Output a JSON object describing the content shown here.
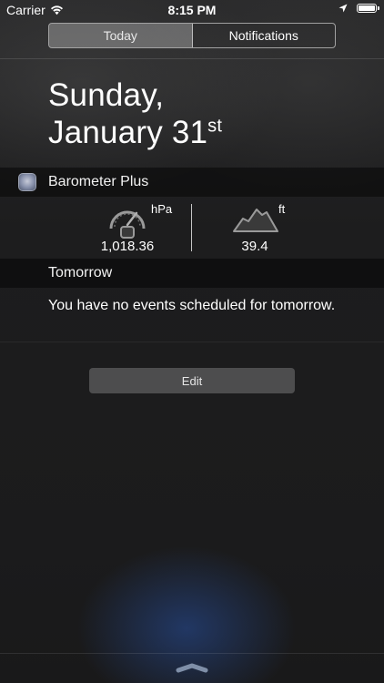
{
  "status_bar": {
    "carrier": "Carrier",
    "time": "8:15 PM",
    "icons": [
      "wifi-icon",
      "location-arrow-icon",
      "battery-icon"
    ]
  },
  "tabs": [
    {
      "label": "Today",
      "selected": true
    },
    {
      "label": "Notifications",
      "selected": false
    }
  ],
  "date": {
    "weekday": "Sunday,",
    "month_day": "January 31",
    "ordinal_suffix": "st"
  },
  "widget": {
    "title": "Barometer Plus",
    "pressure": {
      "unit": "hPa",
      "value": "1,018.36",
      "icon": "barometer-gauge-icon"
    },
    "altitude": {
      "unit": "ft",
      "value": "39.4",
      "icon": "mountain-icon"
    }
  },
  "tomorrow": {
    "header": "Tomorrow",
    "message": "You have no events scheduled for tomorrow."
  },
  "edit_button": {
    "label": "Edit"
  },
  "colors": {
    "background": "#1c1c1e",
    "section_header": "#0d0d0d",
    "text": "#ffffff",
    "glow_accent": "#2850a0"
  }
}
